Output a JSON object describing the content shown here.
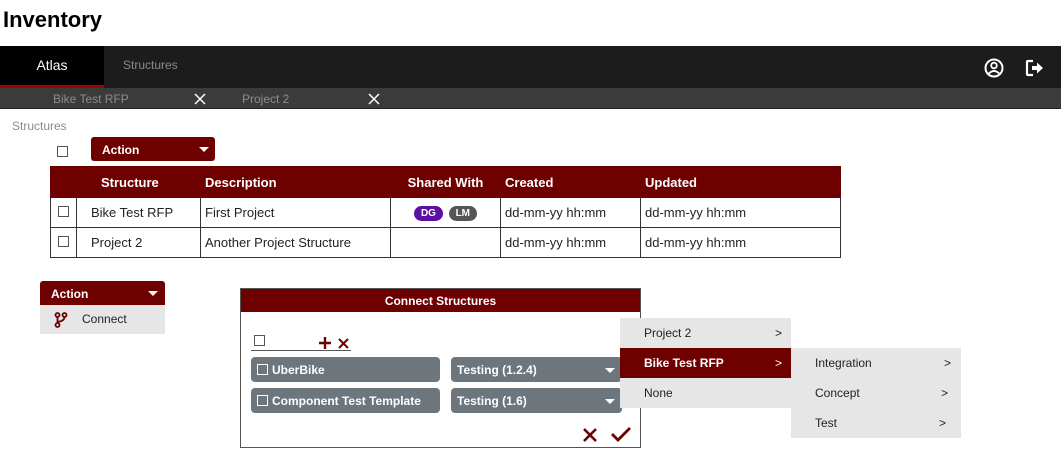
{
  "page": {
    "title": "Inventory"
  },
  "nav": {
    "tabs": [
      "Atlas",
      "Structures"
    ],
    "icons": [
      "user-circle-icon",
      "logout-icon"
    ]
  },
  "subtabs": [
    {
      "label": "Bike Test RFP"
    },
    {
      "label": "Project 2"
    }
  ],
  "breadcrumb": "Structures",
  "action_button": {
    "label": "Action"
  },
  "table": {
    "headers": [
      "Structure",
      "Description",
      "Shared With",
      "Created",
      "Updated"
    ],
    "rows": [
      {
        "structure": "Bike Test RFP",
        "description": "First Project",
        "shared": [
          "DG",
          "LM"
        ],
        "created": "dd-mm-yy hh:mm",
        "updated": "dd-mm-yy hh:mm"
      },
      {
        "structure": "Project 2",
        "description": "Another Project Structure",
        "shared": [],
        "created": "dd-mm-yy hh:mm",
        "updated": "dd-mm-yy hh:mm"
      }
    ]
  },
  "colors": {
    "accent": "#6e0000",
    "badge_dg": "#5c0fa3",
    "badge_lm": "#555555"
  },
  "action_menu": {
    "label": "Action",
    "items": [
      {
        "label": "Connect",
        "icon": "branch-icon"
      }
    ]
  },
  "dialog": {
    "title": "Connect Structures",
    "rows": [
      {
        "name": "UberBike",
        "version": "Testing (1.2.4)"
      },
      {
        "name": "Component Test Template",
        "version": "Testing (1.6)"
      }
    ]
  },
  "context_menu": {
    "level1": [
      {
        "label": "Project 2",
        "arrow": ">"
      },
      {
        "label": "Bike Test RFP",
        "arrow": ">"
      },
      {
        "label": "None",
        "arrow": ""
      }
    ],
    "level2": [
      {
        "label": "Integration",
        "arrow": ">"
      },
      {
        "label": "Concept",
        "arrow": ">"
      },
      {
        "label": "Test",
        "arrow": ">"
      }
    ]
  }
}
